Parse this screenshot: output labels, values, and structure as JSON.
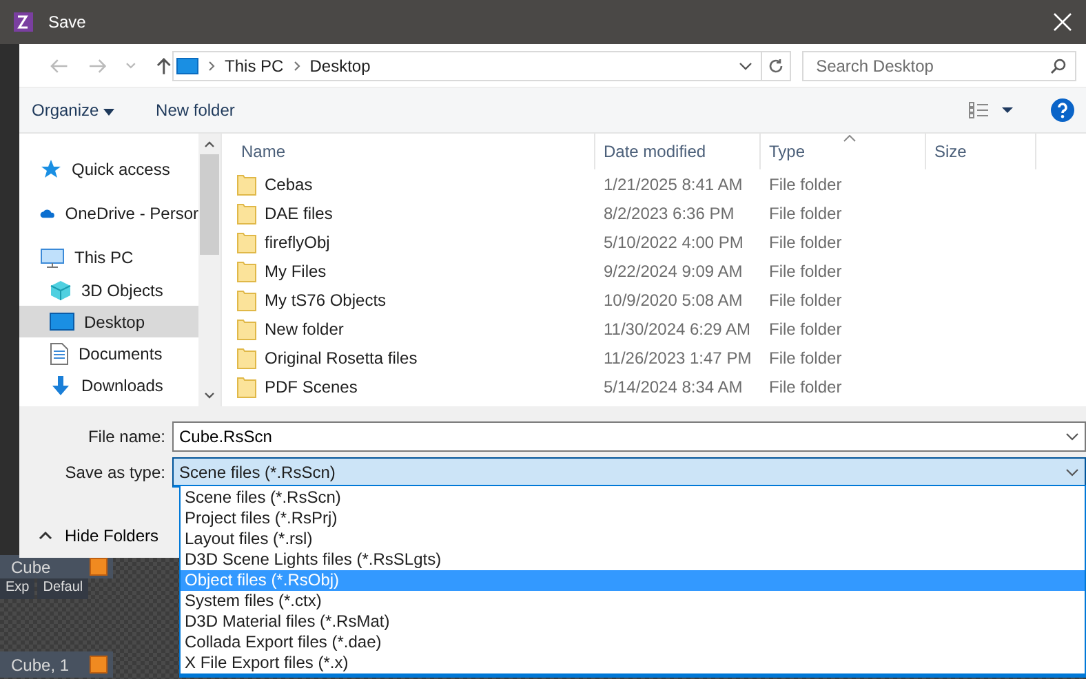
{
  "window": {
    "title": "Save"
  },
  "navigation": {
    "path": [
      "This PC",
      "Desktop"
    ],
    "search": {
      "placeholder": "Search Desktop"
    }
  },
  "toolbar": {
    "organize": "Organize",
    "new_folder": "New folder"
  },
  "nav_pane": {
    "items": [
      {
        "label": "Quick access",
        "kind": "star",
        "selected": false
      },
      {
        "label": "OneDrive - Persor",
        "kind": "cloud",
        "selected": false
      },
      {
        "label": "This PC",
        "kind": "pc",
        "selected": false,
        "children": [
          {
            "label": "3D Objects",
            "kind": "cube",
            "selected": false
          },
          {
            "label": "Desktop",
            "kind": "desktop",
            "selected": true
          },
          {
            "label": "Documents",
            "kind": "document",
            "selected": false
          },
          {
            "label": "Downloads",
            "kind": "download",
            "selected": false
          }
        ]
      }
    ]
  },
  "file_list": {
    "columns": [
      {
        "label": "Name",
        "sorted": false
      },
      {
        "label": "Date modified",
        "sorted": false
      },
      {
        "label": "Type",
        "sorted": true
      },
      {
        "label": "Size",
        "sorted": false
      }
    ],
    "rows": [
      {
        "name": "Cebas",
        "date": "1/21/2025 8:41 AM",
        "type": "File folder"
      },
      {
        "name": "DAE files",
        "date": "8/2/2023 6:36 PM",
        "type": "File folder"
      },
      {
        "name": "fireflyObj",
        "date": "5/10/2022 4:00 PM",
        "type": "File folder"
      },
      {
        "name": "My Files",
        "date": "9/22/2024 9:09 AM",
        "type": "File folder"
      },
      {
        "name": "My tS76 Objects",
        "date": "10/9/2020 5:08 AM",
        "type": "File folder"
      },
      {
        "name": "New folder",
        "date": "11/30/2024 6:29 AM",
        "type": "File folder"
      },
      {
        "name": "Original Rosetta files",
        "date": "11/26/2023 1:47 PM",
        "type": "File folder"
      },
      {
        "name": "PDF Scenes",
        "date": "5/14/2024 8:34 AM",
        "type": "File folder"
      }
    ]
  },
  "file_name": {
    "label": "File name:",
    "value": "Cube.RsScn"
  },
  "save_as_type": {
    "label": "Save as type:",
    "value": "Scene files (*.RsScn)",
    "expanded": true,
    "options": [
      {
        "label": "Scene files (*.RsScn)",
        "highlighted": false
      },
      {
        "label": "Project files (*.RsPrj)",
        "highlighted": false
      },
      {
        "label": "Layout files (*.rsl)",
        "highlighted": false
      },
      {
        "label": "D3D Scene Lights files (*.RsSLgts)",
        "highlighted": false
      },
      {
        "label": "Object files (*.RsObj)",
        "highlighted": true
      },
      {
        "label": "System files (*.ctx)",
        "highlighted": false
      },
      {
        "label": "D3D Material files (*.RsMat)",
        "highlighted": false
      },
      {
        "label": "Collada Export files (*.dae)",
        "highlighted": false
      },
      {
        "label": "X File Export files (*.x)",
        "highlighted": false
      }
    ]
  },
  "hide_folders": "Hide Folders",
  "background_app": {
    "object_row": "Cube",
    "tabs": [
      "Exp",
      "Defaul"
    ],
    "layer_row": "Cube, 1"
  }
}
